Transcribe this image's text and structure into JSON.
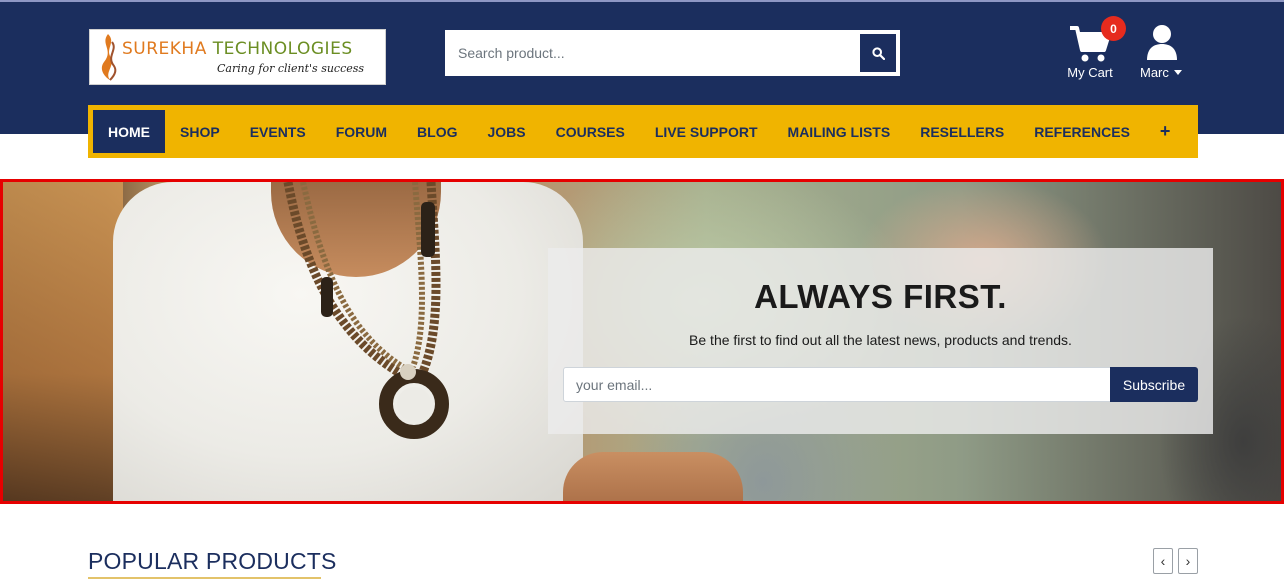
{
  "brand": {
    "name_part1": "SUREKHA ",
    "name_part2": "TECHNOLOGIES",
    "tagline": "Caring for client's success"
  },
  "search": {
    "placeholder": "Search product...",
    "button_icon": "search-icon"
  },
  "cart": {
    "label": "My Cart",
    "count": "0",
    "icon": "cart-icon"
  },
  "user": {
    "name": "Marc",
    "icon": "user-icon"
  },
  "nav": {
    "items": [
      {
        "label": "HOME",
        "active": true
      },
      {
        "label": "SHOP"
      },
      {
        "label": "EVENTS"
      },
      {
        "label": "FORUM"
      },
      {
        "label": "BLOG"
      },
      {
        "label": "JOBS"
      },
      {
        "label": "COURSES"
      },
      {
        "label": "LIVE SUPPORT"
      },
      {
        "label": "MAILING LISTS"
      },
      {
        "label": "RESELLERS"
      },
      {
        "label": "REFERENCES"
      }
    ],
    "more": "+"
  },
  "hero": {
    "title": "ALWAYS FIRST.",
    "subtitle": "Be the first to find out all the latest news, products and trends.",
    "email_placeholder": "your email...",
    "subscribe_label": "Subscribe"
  },
  "popular": {
    "title": "POPULAR PRODUCTS",
    "prev": "‹",
    "next": "›"
  },
  "colors": {
    "header_bg": "#1b2e5e",
    "nav_bg": "#f0b400",
    "badge": "#e62b1e",
    "highlight_border": "#e60000"
  }
}
